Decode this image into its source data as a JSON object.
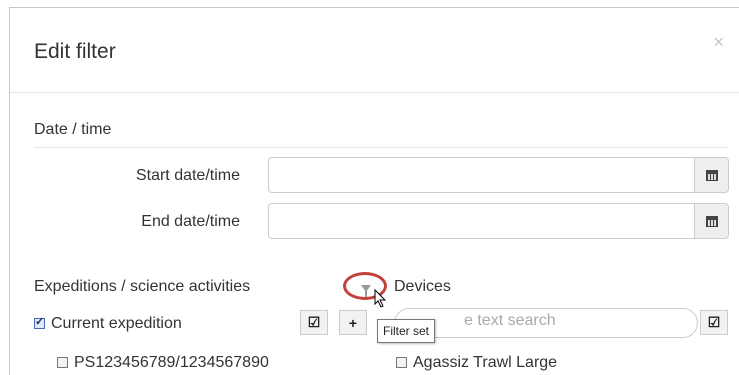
{
  "dialog": {
    "title": "Edit filter",
    "close": "×"
  },
  "datetime": {
    "section_title": "Date / time",
    "start_label": "Start date/time",
    "start_value": "",
    "end_label": "End date/time",
    "end_value": ""
  },
  "expeditions": {
    "title": "Expeditions / science activities",
    "current_label": "Current expedition",
    "current_checked": true,
    "item_label": "PS123456789/1234567890"
  },
  "devices": {
    "title": "Devices",
    "search_placeholder": "e text search",
    "item_label": "Agassiz Trawl Large"
  },
  "toolbar": {
    "select_all_glyph": "☑",
    "add_glyph": "+",
    "filter_icon": "filter-icon"
  },
  "tooltip": {
    "text": "Filter set"
  },
  "colors": {
    "highlight_circle": "#c4413a"
  }
}
